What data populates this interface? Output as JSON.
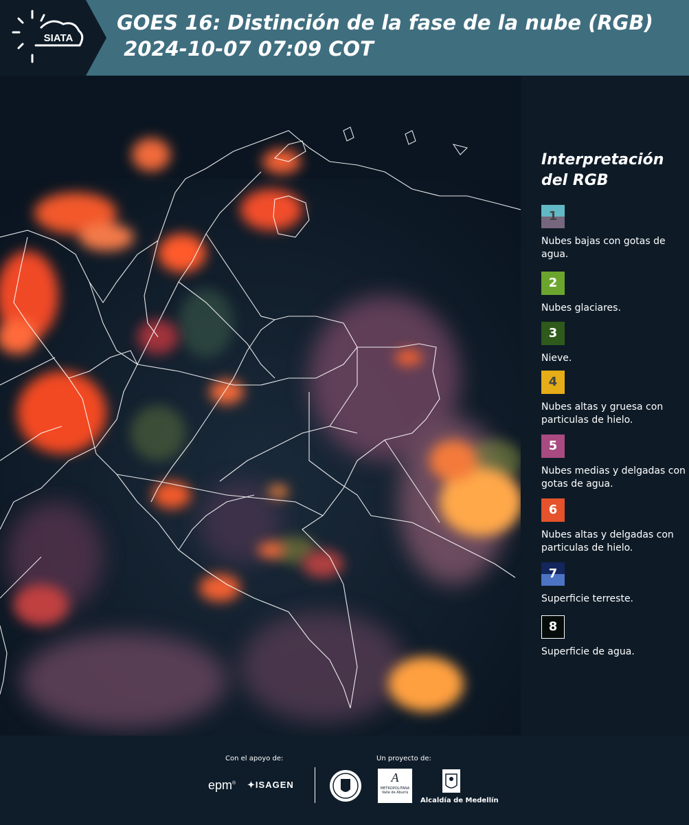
{
  "header": {
    "logo_text": "SIATA",
    "title_line1": "GOES 16: Distinción de la fase de la nube (RGB)",
    "title_line2": " 2024-10-07 07:09 COT"
  },
  "legend": {
    "title": "Interpretación del RGB",
    "items": [
      {
        "number": "1",
        "label": "Nubes bajas con gotas de agua.",
        "color_top": "#62b9c6",
        "color_bottom": "#76667e"
      },
      {
        "number": "2",
        "label": "Nubes glaciares.",
        "color_top": "#6ba52e",
        "color_bottom": "#6ba52e"
      },
      {
        "number": "3",
        "label": "Nieve.",
        "color_top": "#2f5a1b",
        "color_bottom": "#2f5a1b"
      },
      {
        "number": "4",
        "label": "Nubes altas y gruesa con particulas de hielo.",
        "color_top": "#e5ad18",
        "color_bottom": "#e5ad18"
      },
      {
        "number": "5",
        "label": "Nubes medias y delgadas con gotas de agua.",
        "color_top": "#a94a81",
        "color_bottom": "#a94a81"
      },
      {
        "number": "6",
        "label": "Nubes altas y delgadas con particulas de hielo.",
        "color_top": "#e5522b",
        "color_bottom": "#e5522b"
      },
      {
        "number": "7",
        "label": "Superficie terreste.",
        "color_top": "#13265e",
        "color_bottom": "#4c73c4"
      },
      {
        "number": "8",
        "label": "Superficie de agua.",
        "color_top": "#050c0a",
        "color_bottom": "#050c0a"
      }
    ]
  },
  "footer": {
    "support_label": "Con el apoyo de:",
    "project_label": "Un proyecto de:",
    "epm_logo": "epm",
    "isagen_logo": "ISAGEN",
    "area_logo_line1": "METROPOLITANA",
    "area_logo_line2": "Valle de Aburrá",
    "alcaldia_label": "Alcaldía de Medellín"
  }
}
